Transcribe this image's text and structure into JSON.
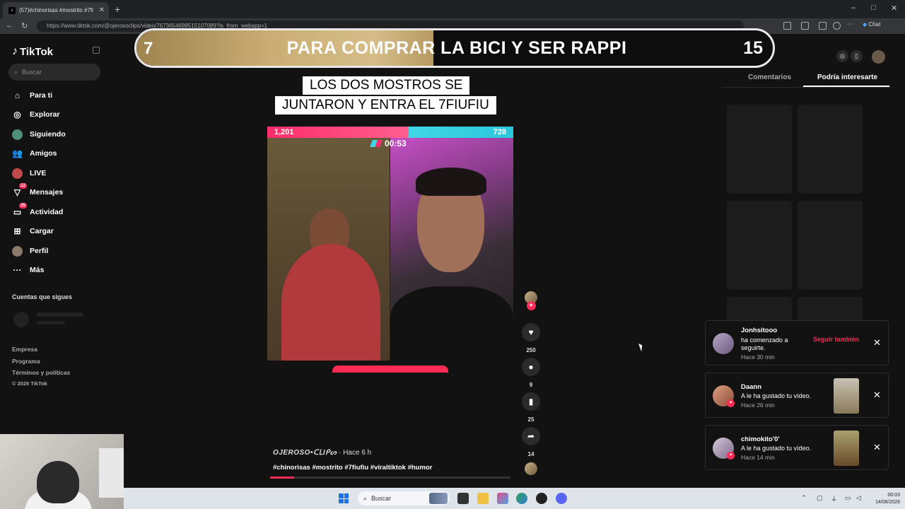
{
  "browser": {
    "tab_title": "(57)#chinorisas #mostrito #7fi",
    "tab_favicon": "tiktok-icon",
    "new_tab": "+",
    "url": "https://www.tiktok.com/@ojerosoclips/video/7673654698515107089?is_from_webapp=1",
    "chat_label": "Chat",
    "window_controls": [
      "–",
      "□",
      "✕"
    ]
  },
  "sidebar": {
    "logo": "TikTok",
    "search_placeholder": "Buscar",
    "nav": [
      {
        "label": "Para ti",
        "icon": "home-icon"
      },
      {
        "label": "Explorar",
        "icon": "compass-icon"
      },
      {
        "label": "Siguiendo",
        "icon": "following-icon"
      },
      {
        "label": "Amigos",
        "icon": "friends-icon"
      },
      {
        "label": "LIVE",
        "icon": "live-icon"
      },
      {
        "label": "Mensajes",
        "icon": "messages-icon",
        "badge": "12"
      },
      {
        "label": "Actividad",
        "icon": "activity-icon",
        "badge": "25"
      },
      {
        "label": "Cargar",
        "icon": "upload-icon"
      },
      {
        "label": "Perfil",
        "icon": "profile-icon"
      },
      {
        "label": "Más",
        "icon": "more-icon"
      }
    ],
    "following_heading": "Cuentas que sigues",
    "footer": [
      "Empresa",
      "Programa",
      "Términos y políticas",
      "© 2026 TikTok"
    ]
  },
  "video": {
    "banner_left": "7",
    "banner_text": "PARA COMPRAR LA BICI Y SER RAPPI",
    "banner_right": "15",
    "caption_line1": "LOS DOS MOSTROS SE",
    "caption_line2": "JUNTARON Y ENTRA EL 7FIUFIU",
    "battle_left": "1,201",
    "battle_right": "728",
    "timer": "00:53",
    "author": "OJEROSO•ᑕᒪIᑭᔕ",
    "time_ago": "· Hace 6 h",
    "hashtags": "#chinorisas #mostrito #7fiufiu #viraltiktok #humor",
    "progress_fraction": 0.1,
    "actions": {
      "likes": "250",
      "comments": "9",
      "saves": "25",
      "shares": "14"
    }
  },
  "right_panel": {
    "tabs": [
      "Comentarios",
      "Podría interesarte"
    ],
    "active_tab": "Podría interesarte"
  },
  "notifications": [
    {
      "user": "Jonhsitooo",
      "message_line1": "ha comenzado a",
      "message_line2": "seguirte.",
      "time": "Hace 30 min",
      "action": "Seguir también"
    },
    {
      "user": "Daann",
      "message_line1": "A le ha gustado tu vídeo.",
      "time": "Hace 26 min"
    },
    {
      "user": "chimokito'0'",
      "message_line1": "A le ha gustado tu vídeo.",
      "time": "Hace 14 min"
    }
  ],
  "taskbar": {
    "search_label": "Buscar",
    "time": "00:03",
    "date": "14/08/2026"
  },
  "colors": {
    "accent": "#fe2c55",
    "battle_red": "#ff2d6a",
    "battle_blue": "#3fd6e6"
  }
}
